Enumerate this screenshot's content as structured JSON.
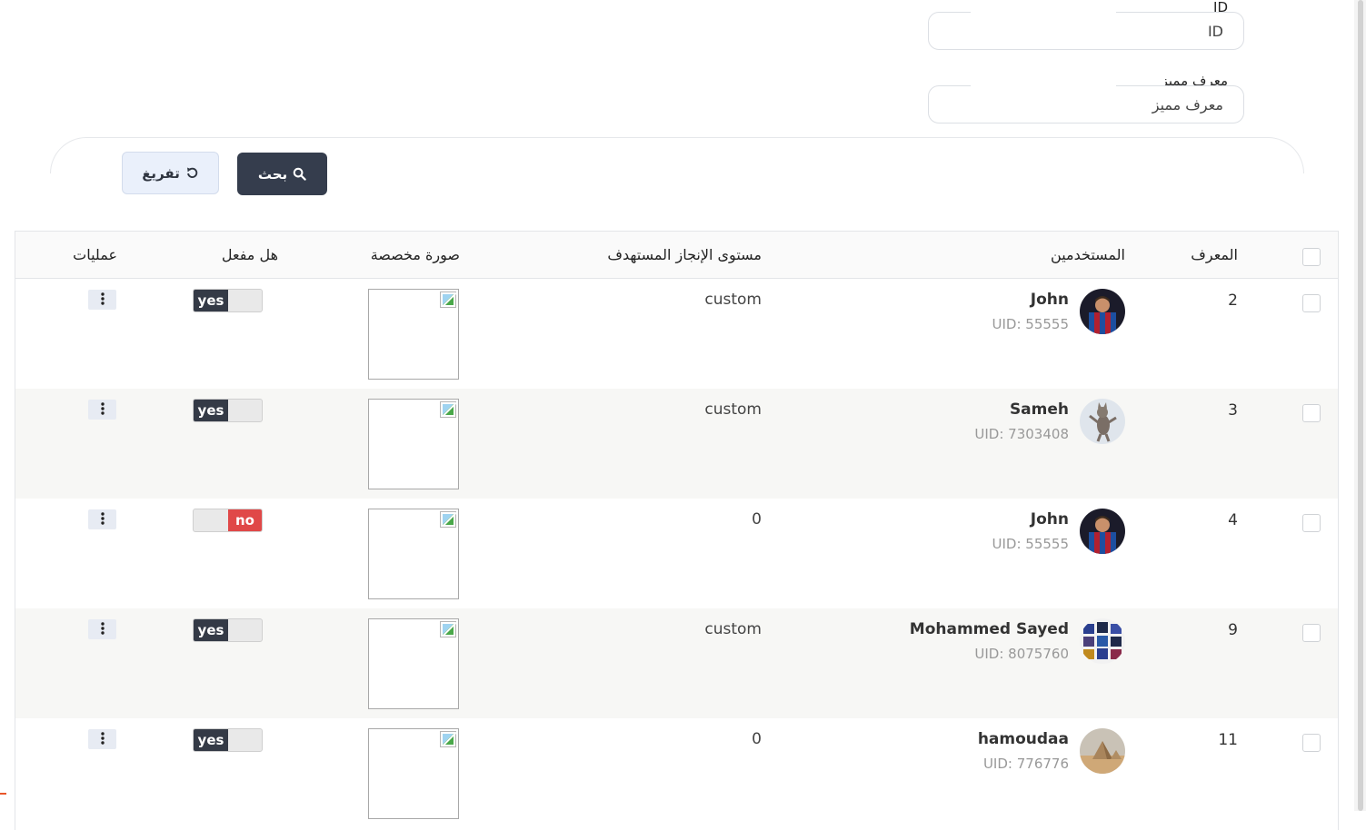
{
  "filters": {
    "id_field": {
      "label": "ID",
      "placeholder": "ID",
      "value": ""
    },
    "uid_field": {
      "label": "معرف مميز",
      "placeholder": "معرف مميز",
      "value": ""
    }
  },
  "buttons": {
    "search_label": "بحث",
    "reset_label": "تفريغ"
  },
  "table": {
    "headers": {
      "id": "المعرف",
      "users": "المستخدمين",
      "target_level": "مستوى الإنجاز المستهدف",
      "custom_image": "صورة مخصصة",
      "is_active": "هل مفعل",
      "operations": "عمليات"
    },
    "rows": [
      {
        "id": "2",
        "name": "John",
        "uid": "UID: 55555",
        "level": "custom",
        "active": true,
        "toggle_label": "yes",
        "avatar": "messi"
      },
      {
        "id": "3",
        "name": "Sameh",
        "uid": "UID: 7303408",
        "level": "custom",
        "active": true,
        "toggle_label": "yes",
        "avatar": "cat"
      },
      {
        "id": "4",
        "name": "John",
        "uid": "UID: 55555",
        "level": "0",
        "active": false,
        "toggle_label": "no",
        "avatar": "messi"
      },
      {
        "id": "9",
        "name": "Mohammed Sayed",
        "uid": "UID: 8075760",
        "level": "custom",
        "active": true,
        "toggle_label": "yes",
        "avatar": "grid"
      },
      {
        "id": "11",
        "name": "hamoudaa",
        "uid": "UID: 776776",
        "level": "0",
        "active": true,
        "toggle_label": "yes",
        "avatar": "pyramids"
      }
    ]
  },
  "colors": {
    "dark_button": "#353d4d",
    "reset_button": "#eaf0fb",
    "toggle_on": "#343a46",
    "toggle_off": "#e04848",
    "alt_row": "#f7f7f5"
  }
}
